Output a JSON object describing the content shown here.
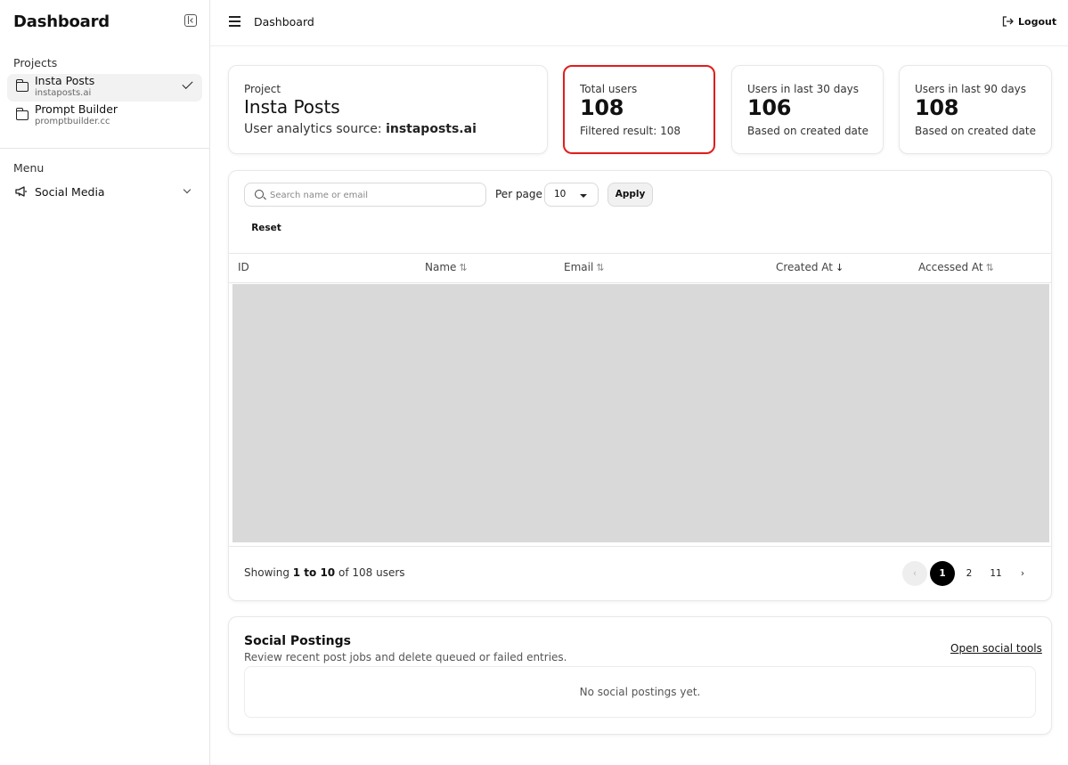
{
  "sidebar": {
    "title": "Dashboard",
    "projects_heading": "Projects",
    "projects": [
      {
        "name": "Insta Posts",
        "url": "instaposts.ai",
        "selected": true
      },
      {
        "name": "Prompt Builder",
        "url": "promptbuilder.cc",
        "selected": false
      }
    ],
    "menu_heading": "Menu",
    "menu_items": [
      {
        "label": "Social Media",
        "icon": "megaphone-icon"
      }
    ]
  },
  "topbar": {
    "breadcrumb": "Dashboard",
    "logout_label": "Logout"
  },
  "cards": {
    "project": {
      "label": "Project",
      "title": "Insta Posts",
      "source_prefix": "User analytics source:",
      "source_value": "instaposts.ai"
    },
    "total_users": {
      "label": "Total users",
      "value": "108",
      "sub": "Filtered result: 108",
      "highlight_color": "#e11d1d"
    },
    "last_30": {
      "label": "Users in last 30 days",
      "value": "106",
      "sub": "Based on created date"
    },
    "last_90": {
      "label": "Users in last 90 days",
      "value": "108",
      "sub": "Based on created date"
    }
  },
  "filters": {
    "search_placeholder": "Search name or email",
    "per_page_label": "Per page",
    "per_page_value": "10",
    "apply_label": "Apply",
    "reset_label": "Reset"
  },
  "table": {
    "columns": [
      {
        "label": "ID",
        "sort": "none"
      },
      {
        "label": "Name",
        "sort": "both"
      },
      {
        "label": "Email",
        "sort": "both"
      },
      {
        "label": "Created At",
        "sort": "desc"
      },
      {
        "label": "Accessed At",
        "sort": "both"
      }
    ],
    "sort_glyph_both": "⇅",
    "sort_glyph_desc": "↓"
  },
  "pagination": {
    "showing_prefix": "Showing",
    "showing_range": "1 to 10",
    "showing_of": "of",
    "showing_total": "108 users",
    "prev_glyph": "‹",
    "pages": [
      "1",
      "2",
      "11"
    ],
    "current_page": "1",
    "next_glyph": "›"
  },
  "social": {
    "title": "Social Postings",
    "subtitle": "Review recent post jobs and delete queued or failed entries.",
    "link_label": "Open social tools",
    "empty_text": "No social postings yet."
  }
}
